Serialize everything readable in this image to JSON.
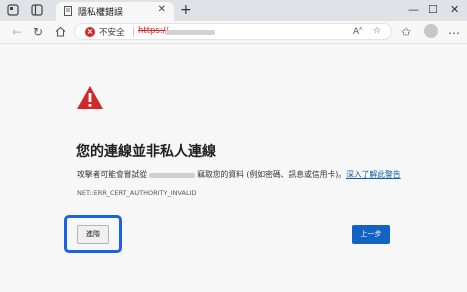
{
  "browser": {
    "tab_title": "隱私權錯誤",
    "tab_close": "✕",
    "new_tab": "+",
    "window_controls": {
      "minimize": "—",
      "maximize": "☐",
      "close": "✕"
    },
    "address_bar": {
      "security_label": "不安全",
      "scheme": "https://",
      "url_text_visible": false
    },
    "icons": [
      "profile-icon",
      "tab-actions-icon",
      "back-icon",
      "refresh-icon",
      "home-icon",
      "read-aloud-icon",
      "favorite-icon",
      "favorites-icon",
      "profile-avatar-icon",
      "more-icon"
    ]
  },
  "page": {
    "heading": "您的連線並非私人連線",
    "description_before": "攻擊者可能會嘗試從",
    "description_after": "竊取您的資料 (例如密碼、訊息或信用卡)。",
    "learn_more_link": "深入了解此警告",
    "error_code": "NET::ERR_CERT_AUTHORITY_INVALID",
    "advanced_button": "進階",
    "back_button": "上一步"
  },
  "colors": {
    "warning_red": "#d12929",
    "link_blue": "#0f5ea8",
    "primary_button": "#1263c4",
    "focus_ring": "#1b62e8"
  }
}
